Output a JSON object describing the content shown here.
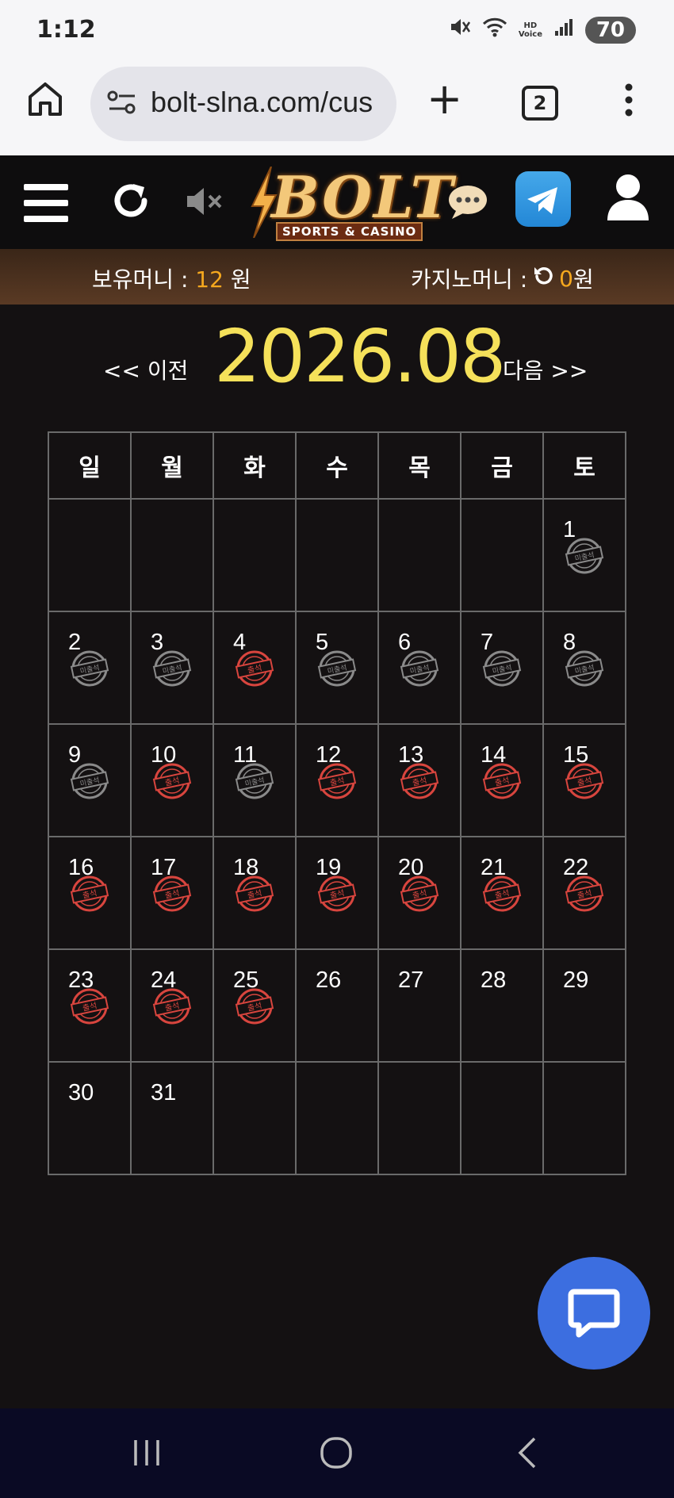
{
  "status_bar": {
    "time": "1:12",
    "battery": "70",
    "network_label": "HD Voice"
  },
  "browser": {
    "url": "bolt-slna.com/cus",
    "tab_count": "2"
  },
  "site": {
    "logo_text": "BOLT",
    "logo_subtitle": "SPORTS & CASINO"
  },
  "money": {
    "holding_label": "보유머니 : ",
    "holding_value": "12",
    "holding_unit": " 원",
    "casino_label": "카지노머니 : ",
    "casino_value": "0",
    "casino_unit": " 원"
  },
  "month_nav": {
    "prev": "<< 이전",
    "title": "2026.08",
    "next": "다음 >>"
  },
  "calendar": {
    "weekdays": [
      "일",
      "월",
      "화",
      "수",
      "목",
      "금",
      "토"
    ],
    "stamp_labels": {
      "attended": "출석",
      "absent": "미출석"
    },
    "colors": {
      "attended": "#d8453e",
      "absent": "#8a8a8a"
    },
    "weeks": [
      [
        null,
        null,
        null,
        null,
        null,
        null,
        {
          "day": "1",
          "status": "absent"
        }
      ],
      [
        {
          "day": "2",
          "status": "absent"
        },
        {
          "day": "3",
          "status": "absent"
        },
        {
          "day": "4",
          "status": "attended"
        },
        {
          "day": "5",
          "status": "absent"
        },
        {
          "day": "6",
          "status": "absent"
        },
        {
          "day": "7",
          "status": "absent"
        },
        {
          "day": "8",
          "status": "absent"
        }
      ],
      [
        {
          "day": "9",
          "status": "absent"
        },
        {
          "day": "10",
          "status": "attended"
        },
        {
          "day": "11",
          "status": "absent"
        },
        {
          "day": "12",
          "status": "attended"
        },
        {
          "day": "13",
          "status": "attended"
        },
        {
          "day": "14",
          "status": "attended"
        },
        {
          "day": "15",
          "status": "attended"
        }
      ],
      [
        {
          "day": "16",
          "status": "attended"
        },
        {
          "day": "17",
          "status": "attended"
        },
        {
          "day": "18",
          "status": "attended"
        },
        {
          "day": "19",
          "status": "attended"
        },
        {
          "day": "20",
          "status": "attended"
        },
        {
          "day": "21",
          "status": "attended"
        },
        {
          "day": "22",
          "status": "attended"
        }
      ],
      [
        {
          "day": "23",
          "status": "attended"
        },
        {
          "day": "24",
          "status": "attended"
        },
        {
          "day": "25",
          "status": "attended"
        },
        {
          "day": "26",
          "status": "none"
        },
        {
          "day": "27",
          "status": "none"
        },
        {
          "day": "28",
          "status": "none"
        },
        {
          "day": "29",
          "status": "none"
        }
      ],
      [
        {
          "day": "30",
          "status": "none"
        },
        {
          "day": "31",
          "status": "none"
        },
        null,
        null,
        null,
        null,
        null
      ]
    ]
  },
  "icons": {
    "header": [
      "menu-icon",
      "refresh-icon",
      "mute-icon",
      "chat-icon",
      "telegram-icon",
      "user-icon"
    ],
    "fab": "live-chat-icon"
  },
  "accent_colors": {
    "month_title": "#f5e15a",
    "money_value": "#f5a81e",
    "fab": "#3c6ee0"
  }
}
